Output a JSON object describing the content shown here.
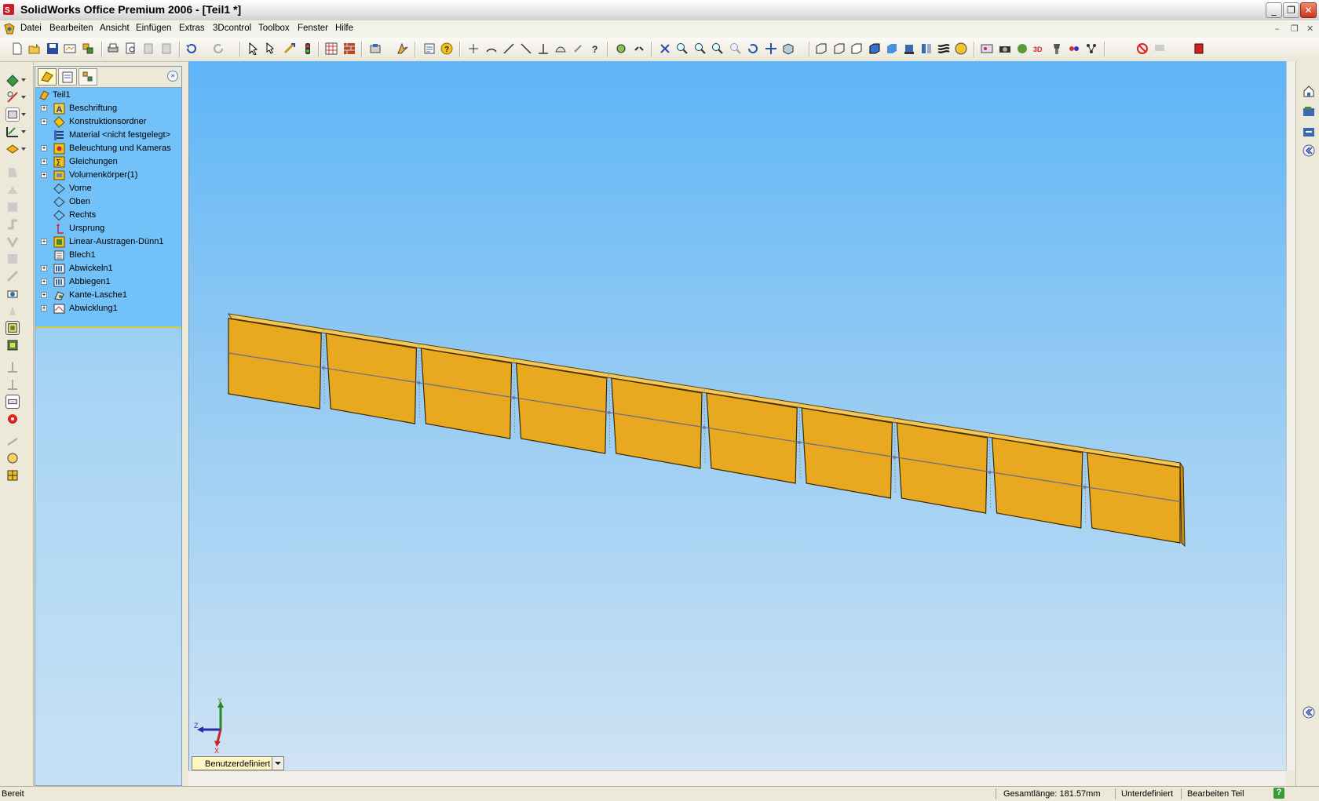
{
  "window": {
    "title": "SolidWorks Office Premium 2006 - [Teil1 *]",
    "minimize_glyph": "_",
    "restore_glyph": "❐",
    "close_glyph": "✕"
  },
  "menu": {
    "items": [
      "Datei",
      "Bearbeiten",
      "Ansicht",
      "Einfügen",
      "Extras",
      "3Dcontrol",
      "Toolbox",
      "Fenster",
      "Hilfe"
    ],
    "doc_min": "–",
    "doc_restore": "❐",
    "doc_close": "✕"
  },
  "featuremanager": {
    "tabs": [
      "featuremanager-icon",
      "propertymanager-icon",
      "configurationmanager-icon"
    ],
    "collapse_glyph": "»",
    "root": "Teil1",
    "items": [
      {
        "label": "Beschriftung",
        "expand": true,
        "icon": "annotations-icon"
      },
      {
        "label": "Konstruktionsordner",
        "expand": true,
        "icon": "design-folder-icon"
      },
      {
        "label": "Material <nicht festgelegt>",
        "expand": false,
        "icon": "material-icon"
      },
      {
        "label": "Beleuchtung und Kameras",
        "expand": true,
        "icon": "lights-icon"
      },
      {
        "label": "Gleichungen",
        "expand": true,
        "icon": "equations-icon"
      },
      {
        "label": "Volumenkörper(1)",
        "expand": true,
        "icon": "solid-bodies-icon"
      },
      {
        "label": "Vorne",
        "expand": false,
        "icon": "plane-icon"
      },
      {
        "label": "Oben",
        "expand": false,
        "icon": "plane-icon"
      },
      {
        "label": "Rechts",
        "expand": false,
        "icon": "plane-icon"
      },
      {
        "label": "Ursprung",
        "expand": false,
        "icon": "origin-icon"
      },
      {
        "label": "Linear-Austragen-Dünn1",
        "expand": true,
        "icon": "extrude-icon"
      },
      {
        "label": "Blech1",
        "expand": false,
        "icon": "sheetmetal-icon"
      },
      {
        "label": "Abwickeln1",
        "expand": true,
        "icon": "unfold-icon"
      },
      {
        "label": "Abbiegen1",
        "expand": true,
        "icon": "fold-icon"
      },
      {
        "label": "Kante-Lasche1",
        "expand": true,
        "icon": "edge-flange-icon"
      },
      {
        "label": "Abwicklung1",
        "expand": true,
        "icon": "flat-pattern-icon"
      }
    ]
  },
  "graphics": {
    "view_orientation": "Benutzerdefiniert",
    "axes": {
      "x": "X",
      "y": "Y",
      "z": "Z"
    },
    "part_color": "#e8a820",
    "segments": 10
  },
  "statusbar": {
    "ready": "Bereit",
    "total_length": "Gesamtlänge: 181.57mm",
    "state": "Unterdefiniert",
    "mode": "Bearbeiten Teil",
    "help": "?"
  }
}
